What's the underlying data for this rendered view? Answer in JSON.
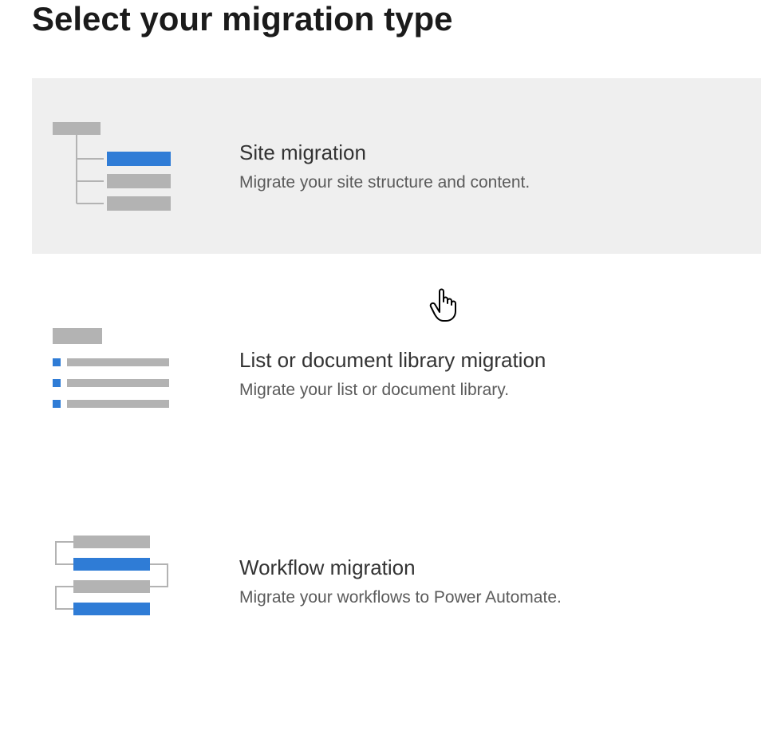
{
  "page": {
    "title": "Select your migration type"
  },
  "options": [
    {
      "title": "Site migration",
      "description": "Migrate your site structure and content.",
      "hovered": true
    },
    {
      "title": "List or document library migration",
      "description": "Migrate your list or document library.",
      "hovered": false
    },
    {
      "title": "Workflow migration",
      "description": "Migrate your workflows to Power Automate.",
      "hovered": false
    }
  ],
  "colors": {
    "accent": "#2f7cd6",
    "gray": "#b3b3b3",
    "hoverBg": "#efefef"
  }
}
